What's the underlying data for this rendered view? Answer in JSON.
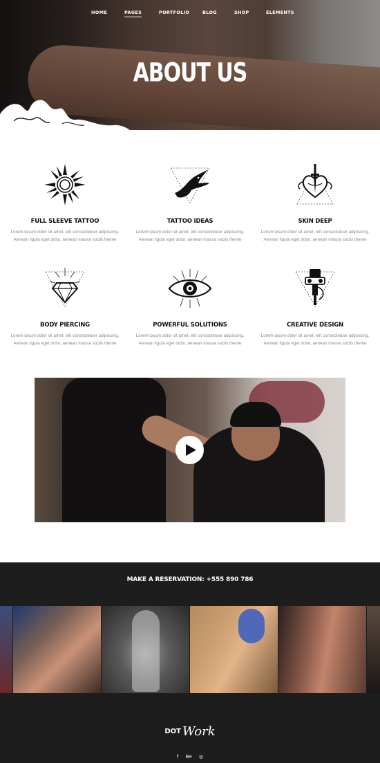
{
  "nav": {
    "items": [
      "HOME",
      "PAGES",
      "PORTFOLIO",
      "BLOG",
      "SHOP",
      "ELEMENTS"
    ],
    "active": "PAGES"
  },
  "hero": {
    "title": "ABOUT US"
  },
  "features": [
    {
      "icon": "sun-icon",
      "title": "FULL SLEEVE TATTOO",
      "text": "Lorem ipsum dolor sit amet, elit consectetuer adipiscing. Aenean ligula eget dolor, aenean massa sociis theme"
    },
    {
      "icon": "swallow-icon",
      "title": "TATTOO IDEAS",
      "text": "Lorem ipsum dolor sit amet, elit consectetuer adipiscing. Aenean ligula eget dolor, aenean massa sociis theme"
    },
    {
      "icon": "heart-dagger-icon",
      "title": "SKIN DEEP",
      "text": "Lorem ipsum dolor sit amet, elit consectetuer adipiscing. Aenean ligula eget dolor, aenean massa sociis theme"
    },
    {
      "icon": "diamond-icon",
      "title": "BODY PIERCING",
      "text": "Lorem ipsum dolor sit amet, elit consectetuer adipiscing. Aenean ligula eget dolor, aenean massa sociis theme"
    },
    {
      "icon": "eye-icon",
      "title": "POWERFUL SOLUTIONS",
      "text": "Lorem ipsum dolor sit amet, elit consectetuer adipiscing. Aenean ligula eget dolor, aenean massa sociis theme"
    },
    {
      "icon": "tattoo-machine-icon",
      "title": "CREATIVE DESIGN",
      "text": "Lorem ipsum dolor sit amet, elit consectetuer adipiscing. Aenean ligula eget dolor, aenean massa sociis theme"
    }
  ],
  "video": {
    "play_icon": "play-icon"
  },
  "reservation": {
    "text": "MAKE A RESERVATION: +555 890 786"
  },
  "footer": {
    "logo_dot": "DOT",
    "logo_work": "Work",
    "social": [
      "f",
      "Be",
      "◎"
    ]
  },
  "colors": {
    "dark": "#1d1d1d",
    "text_muted": "#888888",
    "heading": "#111111"
  }
}
